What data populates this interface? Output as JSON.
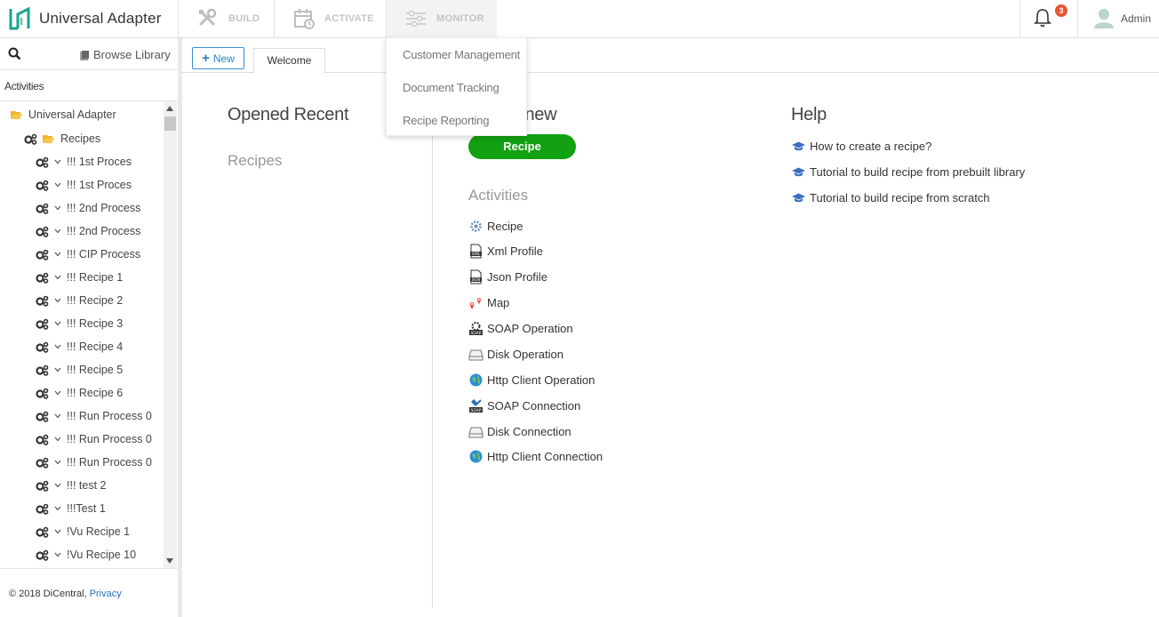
{
  "app": {
    "title": "Universal Adapter",
    "accent": "#16a085"
  },
  "nav": {
    "build": "BUILD",
    "activate": "ACTIVATE",
    "monitor": "MONITOR"
  },
  "monitor_menu": [
    "Customer Management",
    "Document Tracking",
    "Recipe Reporting"
  ],
  "notifications": {
    "count": "3"
  },
  "user": {
    "name": "Admin"
  },
  "sidebar": {
    "browse_library": "Browse Library",
    "activities_header": "Activities",
    "root": "Universal Adapter",
    "folder": "Recipes",
    "items": [
      "!!! 1st Proces",
      "!!! 1st Proces",
      "!!! 2nd Process",
      "!!! 2nd Process",
      "!!! CIP Process",
      "!!! Recipe 1",
      "!!! Recipe 2",
      "!!! Recipe 3",
      "!!! Recipe 4",
      "!!! Recipe 5",
      "!!! Recipe 6",
      "!!! Run Process 0",
      "!!! Run Process 0",
      "!!! Run Process 0",
      "!!! test 2",
      "!!!Test 1",
      "!Vu Recipe 1",
      "!Vu Recipe 10"
    ],
    "footer_copyright": "© 2018 DiCentral,",
    "footer_privacy": "Privacy"
  },
  "tabs": {
    "new_label": "New",
    "welcome_label": "Welcome"
  },
  "welcome": {
    "opened_recent": "Opened Recent",
    "recipes_sub": "Recipes",
    "create_new": "Create new",
    "recipe_button": "Recipe",
    "activities_title": "Activities",
    "activities": [
      {
        "label": "Recipe",
        "icon": "recipe-gear-icon"
      },
      {
        "label": "Xml Profile",
        "icon": "xml-file-icon"
      },
      {
        "label": "Json Profile",
        "icon": "json-file-icon"
      },
      {
        "label": "Map",
        "icon": "map-pin-icon"
      },
      {
        "label": "SOAP Operation",
        "icon": "soap-operation-icon"
      },
      {
        "label": "Disk Operation",
        "icon": "disk-icon"
      },
      {
        "label": "Http Client Operation",
        "icon": "globe-icon"
      },
      {
        "label": "SOAP Connection",
        "icon": "soap-connection-icon"
      },
      {
        "label": "Disk Connection",
        "icon": "disk-icon"
      },
      {
        "label": "Http Client Connection",
        "icon": "globe-icon"
      }
    ],
    "help_title": "Help",
    "help_links": [
      "How to create a recipe?",
      "Tutorial to build recipe from prebuilt library",
      "Tutorial to build recipe from scratch"
    ]
  }
}
